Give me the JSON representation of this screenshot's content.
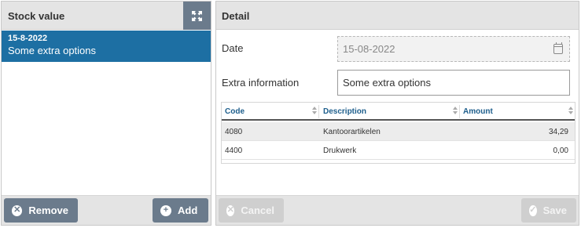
{
  "stock_panel": {
    "title": "Stock value",
    "expand_icon": "expand-arrows-icon",
    "items": [
      {
        "date": "15-8-2022",
        "description": "Some extra options",
        "selected": true
      }
    ],
    "footer": {
      "remove_label": "Remove",
      "add_label": "Add"
    }
  },
  "detail_panel": {
    "title": "Detail",
    "date_label": "Date",
    "date_value": "15-08-2022",
    "extra_label": "Extra information",
    "extra_value": "Some extra options",
    "grid": {
      "columns": [
        "Code",
        "Description",
        "Amount"
      ],
      "rows": [
        {
          "code": "4080",
          "description": "Kantoorartikelen",
          "amount": "34,29"
        },
        {
          "code": "4400",
          "description": "Drukwerk",
          "amount": "0,00"
        }
      ]
    },
    "footer": {
      "cancel_label": "Cancel",
      "save_label": "Save"
    }
  },
  "colors": {
    "selected_row": "#1d6fa3",
    "button_dark": "#6b7b8c",
    "button_disabled": "#cfcfcf",
    "header_bg": "#e4e4e4",
    "column_header_text": "#1d5e8c"
  }
}
